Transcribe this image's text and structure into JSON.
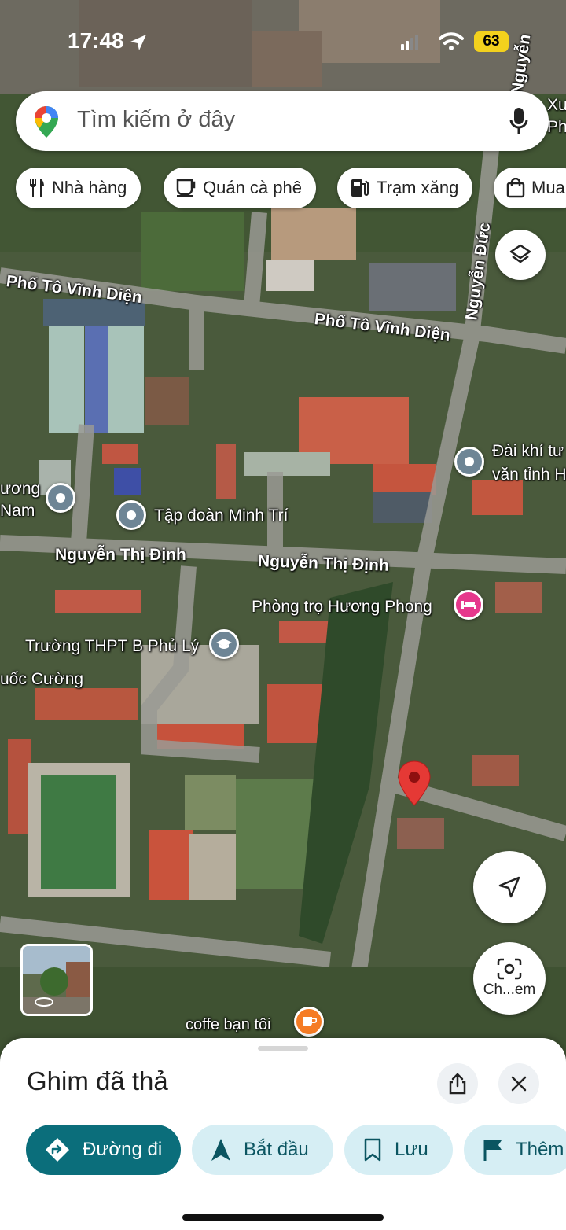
{
  "status_bar": {
    "time": "17:48",
    "battery": "63"
  },
  "search": {
    "placeholder": "Tìm kiếm ở đây"
  },
  "chips": [
    {
      "label": "Nhà hàng",
      "icon": "fork-knife-icon"
    },
    {
      "label": "Quán cà phê",
      "icon": "coffee-cup-icon"
    },
    {
      "label": "Trạm xăng",
      "icon": "gas-pump-icon"
    },
    {
      "label": "Mua",
      "icon": "shopping-bag-icon"
    }
  ],
  "map": {
    "streets": [
      "Phố Tô Vĩnh Diện",
      "Phố Tô Vĩnh Diện",
      "Nguyễn Thị Định",
      "Nguyễn Thị Định",
      "Nguyễn Đức",
      "Nguyễn"
    ],
    "places": [
      {
        "label": "Tập đoàn Minh Trí",
        "icon": "place-pin-icon"
      },
      {
        "label": "ương",
        "label2": "Nam",
        "icon": "place-pin-icon"
      },
      {
        "label": "Đài khí tư",
        "label2": "văn tỉnh H",
        "icon": "place-pin-icon"
      },
      {
        "label": "Phòng trọ Hương Phong",
        "icon": "hotel-bed-icon"
      },
      {
        "label": "Trường THPT B Phủ Lý",
        "icon": "school-icon"
      },
      {
        "label": "uốc Cường",
        "icon": "none"
      },
      {
        "label": "coffe bạn tôi",
        "icon": "coffee-cup-icon"
      },
      {
        "label": "Xư",
        "label2": "Ph",
        "icon": "none"
      }
    ],
    "dropped_pin_color": "#e53935",
    "camera_button_label": "Ch...em"
  },
  "sheet": {
    "title": "Ghim đã thả",
    "actions": [
      {
        "label": "Đường đi",
        "icon": "directions-icon"
      },
      {
        "label": "Bắt đầu",
        "icon": "navigation-arrow-icon"
      },
      {
        "label": "Lưu",
        "icon": "bookmark-icon"
      },
      {
        "label": "Thêm",
        "icon": "flag-icon"
      }
    ]
  },
  "colors": {
    "primary": "#0b6e7b",
    "secondary_bg": "#d6eef4",
    "pin_red": "#e53935"
  }
}
